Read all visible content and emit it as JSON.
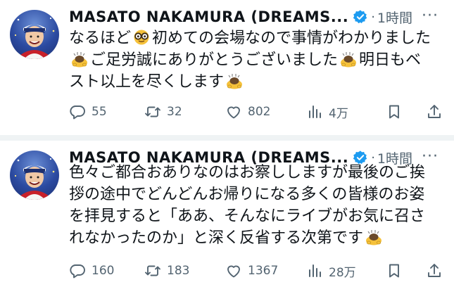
{
  "colors": {
    "text": "#0f1419",
    "secondary": "#536471",
    "verified": "#1d9bf0",
    "divider": "#eff3f4"
  },
  "tweets": [
    {
      "author": "MASATO NAKAMURA (DREAMS...",
      "dot": "·",
      "time": "1時間",
      "more": "···",
      "lines": [
        [
          "なるほど",
          "{face-with-glasses}",
          "初めての会場なので事情がわかりました"
        ],
        [
          "{bowing-person}",
          "ご足労誠にありがとうございました",
          "{bowing-person}",
          "明日もベ"
        ],
        [
          "スト以上を尽くします",
          "{bowing-person}"
        ]
      ],
      "replies": "55",
      "retweets": "32",
      "likes": "802",
      "views": "4万"
    },
    {
      "author": "MASATO NAKAMURA (DREAMS...",
      "dot": "·",
      "time": "1時間",
      "more": "···",
      "lines": [
        [
          "色々ご都合おありなのはお察ししますが最後のご挨"
        ],
        [
          "拶の途中でどんどんお帰りになる多くの皆様のお姿"
        ],
        [
          "を拝見すると「ああ、そんなにライブがお気に召さ"
        ],
        [
          "れなかったのか」と深く反省する次第です",
          "{bowing-person}"
        ]
      ],
      "replies": "160",
      "retweets": "183",
      "likes": "1367",
      "views": "28万"
    }
  ],
  "icons": {
    "reply": "reply-icon",
    "retweet": "retweet-icon",
    "like": "heart-icon",
    "views": "views-bar-chart-icon",
    "bookmark": "bookmark-icon",
    "share": "share-icon",
    "verified": "verified-badge-icon"
  }
}
